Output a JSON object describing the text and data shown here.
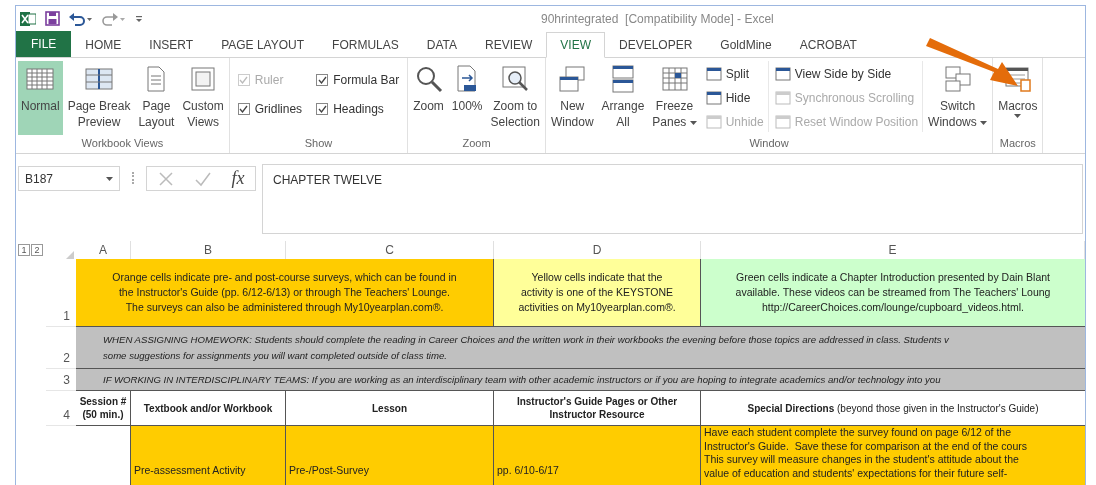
{
  "window": {
    "title": "90hrintegrated  [Compatibility Mode] - Excel"
  },
  "tabs": [
    {
      "label": "FILE",
      "kind": "file",
      "selected": false
    },
    {
      "label": "HOME",
      "kind": "tab",
      "selected": false
    },
    {
      "label": "INSERT",
      "kind": "tab",
      "selected": false
    },
    {
      "label": "PAGE LAYOUT",
      "kind": "tab",
      "selected": false
    },
    {
      "label": "FORMULAS",
      "kind": "tab",
      "selected": false
    },
    {
      "label": "DATA",
      "kind": "tab",
      "selected": false
    },
    {
      "label": "REVIEW",
      "kind": "tab",
      "selected": false
    },
    {
      "label": "VIEW",
      "kind": "tab",
      "selected": true
    },
    {
      "label": "DEVELOPER",
      "kind": "tab",
      "selected": false
    },
    {
      "label": "GoldMine",
      "kind": "tab",
      "selected": false
    },
    {
      "label": "ACROBAT",
      "kind": "tab",
      "selected": false
    }
  ],
  "ribbon": [
    {
      "label": "Workbook Views",
      "items": [
        {
          "kind": "big",
          "label": "Normal",
          "selected": true
        },
        {
          "kind": "big",
          "label": "Page Break\nPreview",
          "selected": false
        },
        {
          "kind": "big",
          "label": "Page\nLayout",
          "selected": false
        },
        {
          "kind": "big",
          "label": "Custom\nViews",
          "selected": false
        }
      ]
    },
    {
      "label": "Show",
      "items": [
        {
          "kind": "checks",
          "items": [
            {
              "label": "Ruler",
              "checked": true,
              "disabled": true
            },
            {
              "label": "Gridlines",
              "checked": true,
              "disabled": false
            }
          ]
        },
        {
          "kind": "checks",
          "items": [
            {
              "label": "Formula Bar",
              "checked": true,
              "disabled": false
            },
            {
              "label": "Headings",
              "checked": true,
              "disabled": false
            }
          ]
        }
      ]
    },
    {
      "label": "Zoom",
      "items": [
        {
          "kind": "big",
          "label": "Zoom"
        },
        {
          "kind": "big",
          "label": "100%"
        },
        {
          "kind": "big",
          "label": "Zoom to\nSelection"
        }
      ]
    },
    {
      "label": "Window",
      "items": [
        {
          "kind": "big",
          "label": "New\nWindow"
        },
        {
          "kind": "big",
          "label": "Arrange\nAll"
        },
        {
          "kind": "big",
          "label": "Freeze\nPanes",
          "dropdown": true
        },
        {
          "kind": "smalls",
          "items": [
            {
              "label": "Split",
              "disabled": false
            },
            {
              "label": "Hide",
              "disabled": false
            },
            {
              "label": "Unhide",
              "disabled": true
            }
          ]
        },
        {
          "kind": "smalls",
          "items": [
            {
              "label": "View Side by Side",
              "disabled": false
            },
            {
              "label": "Synchronous Scrolling",
              "disabled": true
            },
            {
              "label": "Reset Window Position",
              "disabled": true
            }
          ]
        },
        {
          "kind": "big",
          "label": "Switch\nWindows",
          "dropdown": true
        }
      ]
    },
    {
      "label": "Macros",
      "items": [
        {
          "kind": "big",
          "label": "Macros",
          "dropdown": true
        }
      ]
    }
  ],
  "formula_bar": {
    "name_box": "B187",
    "function_label": "fx",
    "formula": "CHAPTER TWELVE"
  },
  "sheet": {
    "outline_levels": [
      "1",
      "2"
    ],
    "columns": [
      "A",
      "B",
      "C",
      "D",
      "E"
    ],
    "legend": {
      "row_header": "1",
      "items": [
        {
          "color": "#ffcc00",
          "text": "Orange cells indicate pre- and post-course surveys, which can be found in\nthe Instructor's Guide (pp. 6/12-6/13) or through The Teachers' Lounge.\nThe surveys can also be administered through My10yearplan.com®."
        },
        {
          "color": "#ffff99",
          "text": "Yellow cells indicate that the\nactivity is one of the KEYSTONE\nactivities on My10yearplan.com®."
        },
        {
          "color": "#ccffcc",
          "text": "Green cells indicate a Chapter Introduction presented by Dain Blant\navailable. These videos can be streamed from The Teachers' Loung\nhttp://CareerChoices.com/lounge/cupboard_videos.html."
        }
      ]
    },
    "notes": [
      {
        "row_header": "2",
        "text": "WHEN ASSIGNING HOMEWORK: Students should complete the reading in Career Choices and the written work in their workbooks the evening before those topics are addressed in class. Students v\nsome suggestions for assignments you will want completed outside of class time."
      },
      {
        "row_header": "3",
        "text": "IF WORKING IN INTERDISCIPLINARY TEAMS: If you are working as an interdisciplinary team with other academic instructors or if you are hoping to integrate academics and/or technology into you"
      }
    ],
    "table": {
      "row_header": "4",
      "columns": [
        "Session #\n(50 min.)",
        "Textbook and/or Workbook",
        "Lesson",
        "Instructor's Guide Pages or Other\nInstructor Resource",
        "**Special Directions** (beyond those given in the Instructor's Guide)"
      ],
      "rows": [
        {
          "cells": [
            {
              "color": "#ffffff"
            },
            {
              "color": "#ffcc00",
              "text": "Pre-assessment Activity"
            },
            {
              "color": "#ffcc00",
              "text": "Pre-/Post-Survey"
            },
            {
              "color": "#ffcc00",
              "text": "pp. 6/10-6/17"
            },
            {
              "color": "#ffcc00",
              "text": "Have each student complete the survey found on page 6/12 of the\nInstructor's Guide.  Save these for comparison at the end of the cours\nThis survey will measure changes in the student's attitude about the\nvalue of education and students' expectations for their future self-"
            }
          ]
        }
      ]
    }
  }
}
